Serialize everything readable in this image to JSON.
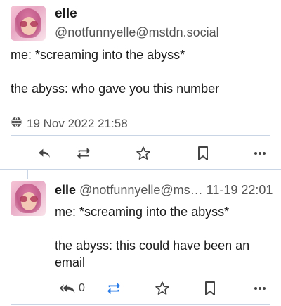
{
  "main_post": {
    "display_name": "elle",
    "handle": "@notfunnyelle@mstdn.social",
    "content": "me: *screaming into the abyss*\n\nthe abyss: who gave you this number",
    "timestamp": "19 Nov 2022 21:58",
    "visibility_icon": "globe-icon",
    "actions": [
      "reply-icon",
      "boost-icon",
      "favourite-icon",
      "bookmark-icon",
      "more-icon"
    ]
  },
  "reply_post": {
    "display_name": "elle",
    "handle": "@notfunnyelle@ms…",
    "timestamp": "11-19 22:01",
    "content": "me: *screaming into the abyss*\n\nthe abyss: this could have been an email",
    "reply_count": "0",
    "boosted": true,
    "actions": [
      "reply-all-icon",
      "boost-icon",
      "favourite-icon",
      "bookmark-icon",
      "more-icon"
    ]
  },
  "colors": {
    "boost_active": "#2b7de9",
    "icon": "#444444",
    "divider": "#c9d4e5"
  }
}
